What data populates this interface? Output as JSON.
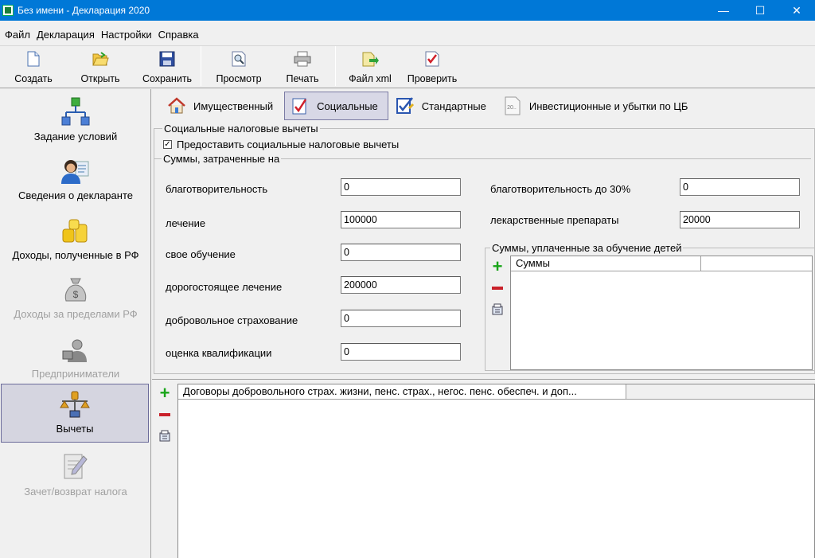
{
  "window": {
    "title": "Без имени - Декларация 2020",
    "min": "—",
    "max": "☐",
    "close": "✕"
  },
  "menu": [
    "Файл",
    "Декларация",
    "Настройки",
    "Справка"
  ],
  "toolbar": {
    "create": "Создать",
    "open": "Открыть",
    "save": "Сохранить",
    "preview": "Просмотр",
    "print": "Печать",
    "xml": "Файл xml",
    "check": "Проверить"
  },
  "nav": [
    {
      "label": "Задание условий",
      "icon": "tree-icon",
      "disabled": false
    },
    {
      "label": "Сведения о декларанте",
      "icon": "person-icon",
      "disabled": false
    },
    {
      "label": "Доходы, полученные в РФ",
      "icon": "coins-icon",
      "disabled": false
    },
    {
      "label": "Доходы за пределами РФ",
      "icon": "money-bag-icon",
      "disabled": true
    },
    {
      "label": "Предприниматели",
      "icon": "businessman-icon",
      "disabled": true
    },
    {
      "label": "Вычеты",
      "icon": "scales-icon",
      "disabled": false,
      "selected": true
    },
    {
      "label": "Зачет/возврат налога",
      "icon": "document-pen-icon",
      "disabled": true
    }
  ],
  "tabs": [
    {
      "label": "Имущественный",
      "icon": "house-icon"
    },
    {
      "label": "Социальные",
      "icon": "checklist-icon",
      "active": true
    },
    {
      "label": "Стандартные",
      "icon": "checkbox-pen-icon"
    },
    {
      "label": "Инвестиционные и убытки по ЦБ",
      "icon": "document-20-icon"
    }
  ],
  "social": {
    "group_title": "Социальные налоговые вычеты",
    "provide_label": "Предоставить социальные налоговые вычеты",
    "provide_checked": true,
    "spent_title": "Суммы, затраченные на",
    "fields_left": [
      {
        "label": "благотворительность",
        "value": "0"
      },
      {
        "label": "лечение",
        "value": "100000"
      },
      {
        "label": "свое обучение",
        "value": "0"
      },
      {
        "label": "дорогостоящее лечение",
        "value": "200000"
      },
      {
        "label": "добровольное страхование",
        "value": "0"
      },
      {
        "label": "оценка квалификации",
        "value": "0"
      }
    ],
    "fields_right": [
      {
        "label": "благотворительность до 30%",
        "value": "0"
      },
      {
        "label": "лекарственные препараты",
        "value": "20000"
      }
    ],
    "children_title": "Суммы, уплаченные за обучение детей",
    "children_col": "Суммы"
  },
  "contracts": {
    "col": "Договоры добровольного страх. жизни, пенс. страх., негос. пенс. обеспеч. и доп..."
  }
}
